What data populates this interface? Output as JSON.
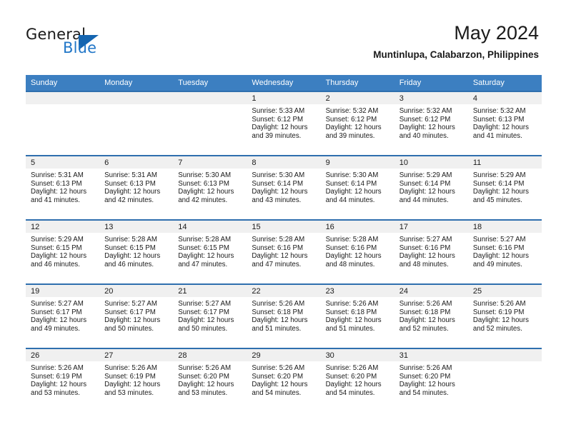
{
  "logo": {
    "word_top": "General",
    "word_bottom": "Blue",
    "triangle_color": "#1565b0",
    "blue_text_color": "#2277c8"
  },
  "header": {
    "title": "May 2024",
    "subtitle": "Muntinlupa, Calabarzon, Philippines"
  },
  "theme": {
    "header_row_bg": "#3c7fc1",
    "row_border": "#2f6fae",
    "daynum_band_bg": "#f0f0f0"
  },
  "weekday_headers": [
    "Sunday",
    "Monday",
    "Tuesday",
    "Wednesday",
    "Thursday",
    "Friday",
    "Saturday"
  ],
  "weeks": [
    [
      {
        "day": "",
        "sunrise": "",
        "sunset": "",
        "daylight_line1": "",
        "daylight_line2": ""
      },
      {
        "day": "",
        "sunrise": "",
        "sunset": "",
        "daylight_line1": "",
        "daylight_line2": ""
      },
      {
        "day": "",
        "sunrise": "",
        "sunset": "",
        "daylight_line1": "",
        "daylight_line2": ""
      },
      {
        "day": "1",
        "sunrise": "Sunrise: 5:33 AM",
        "sunset": "Sunset: 6:12 PM",
        "daylight_line1": "Daylight: 12 hours",
        "daylight_line2": "and 39 minutes."
      },
      {
        "day": "2",
        "sunrise": "Sunrise: 5:32 AM",
        "sunset": "Sunset: 6:12 PM",
        "daylight_line1": "Daylight: 12 hours",
        "daylight_line2": "and 39 minutes."
      },
      {
        "day": "3",
        "sunrise": "Sunrise: 5:32 AM",
        "sunset": "Sunset: 6:12 PM",
        "daylight_line1": "Daylight: 12 hours",
        "daylight_line2": "and 40 minutes."
      },
      {
        "day": "4",
        "sunrise": "Sunrise: 5:32 AM",
        "sunset": "Sunset: 6:13 PM",
        "daylight_line1": "Daylight: 12 hours",
        "daylight_line2": "and 41 minutes."
      }
    ],
    [
      {
        "day": "5",
        "sunrise": "Sunrise: 5:31 AM",
        "sunset": "Sunset: 6:13 PM",
        "daylight_line1": "Daylight: 12 hours",
        "daylight_line2": "and 41 minutes."
      },
      {
        "day": "6",
        "sunrise": "Sunrise: 5:31 AM",
        "sunset": "Sunset: 6:13 PM",
        "daylight_line1": "Daylight: 12 hours",
        "daylight_line2": "and 42 minutes."
      },
      {
        "day": "7",
        "sunrise": "Sunrise: 5:30 AM",
        "sunset": "Sunset: 6:13 PM",
        "daylight_line1": "Daylight: 12 hours",
        "daylight_line2": "and 42 minutes."
      },
      {
        "day": "8",
        "sunrise": "Sunrise: 5:30 AM",
        "sunset": "Sunset: 6:14 PM",
        "daylight_line1": "Daylight: 12 hours",
        "daylight_line2": "and 43 minutes."
      },
      {
        "day": "9",
        "sunrise": "Sunrise: 5:30 AM",
        "sunset": "Sunset: 6:14 PM",
        "daylight_line1": "Daylight: 12 hours",
        "daylight_line2": "and 44 minutes."
      },
      {
        "day": "10",
        "sunrise": "Sunrise: 5:29 AM",
        "sunset": "Sunset: 6:14 PM",
        "daylight_line1": "Daylight: 12 hours",
        "daylight_line2": "and 44 minutes."
      },
      {
        "day": "11",
        "sunrise": "Sunrise: 5:29 AM",
        "sunset": "Sunset: 6:14 PM",
        "daylight_line1": "Daylight: 12 hours",
        "daylight_line2": "and 45 minutes."
      }
    ],
    [
      {
        "day": "12",
        "sunrise": "Sunrise: 5:29 AM",
        "sunset": "Sunset: 6:15 PM",
        "daylight_line1": "Daylight: 12 hours",
        "daylight_line2": "and 46 minutes."
      },
      {
        "day": "13",
        "sunrise": "Sunrise: 5:28 AM",
        "sunset": "Sunset: 6:15 PM",
        "daylight_line1": "Daylight: 12 hours",
        "daylight_line2": "and 46 minutes."
      },
      {
        "day": "14",
        "sunrise": "Sunrise: 5:28 AM",
        "sunset": "Sunset: 6:15 PM",
        "daylight_line1": "Daylight: 12 hours",
        "daylight_line2": "and 47 minutes."
      },
      {
        "day": "15",
        "sunrise": "Sunrise: 5:28 AM",
        "sunset": "Sunset: 6:16 PM",
        "daylight_line1": "Daylight: 12 hours",
        "daylight_line2": "and 47 minutes."
      },
      {
        "day": "16",
        "sunrise": "Sunrise: 5:28 AM",
        "sunset": "Sunset: 6:16 PM",
        "daylight_line1": "Daylight: 12 hours",
        "daylight_line2": "and 48 minutes."
      },
      {
        "day": "17",
        "sunrise": "Sunrise: 5:27 AM",
        "sunset": "Sunset: 6:16 PM",
        "daylight_line1": "Daylight: 12 hours",
        "daylight_line2": "and 48 minutes."
      },
      {
        "day": "18",
        "sunrise": "Sunrise: 5:27 AM",
        "sunset": "Sunset: 6:16 PM",
        "daylight_line1": "Daylight: 12 hours",
        "daylight_line2": "and 49 minutes."
      }
    ],
    [
      {
        "day": "19",
        "sunrise": "Sunrise: 5:27 AM",
        "sunset": "Sunset: 6:17 PM",
        "daylight_line1": "Daylight: 12 hours",
        "daylight_line2": "and 49 minutes."
      },
      {
        "day": "20",
        "sunrise": "Sunrise: 5:27 AM",
        "sunset": "Sunset: 6:17 PM",
        "daylight_line1": "Daylight: 12 hours",
        "daylight_line2": "and 50 minutes."
      },
      {
        "day": "21",
        "sunrise": "Sunrise: 5:27 AM",
        "sunset": "Sunset: 6:17 PM",
        "daylight_line1": "Daylight: 12 hours",
        "daylight_line2": "and 50 minutes."
      },
      {
        "day": "22",
        "sunrise": "Sunrise: 5:26 AM",
        "sunset": "Sunset: 6:18 PM",
        "daylight_line1": "Daylight: 12 hours",
        "daylight_line2": "and 51 minutes."
      },
      {
        "day": "23",
        "sunrise": "Sunrise: 5:26 AM",
        "sunset": "Sunset: 6:18 PM",
        "daylight_line1": "Daylight: 12 hours",
        "daylight_line2": "and 51 minutes."
      },
      {
        "day": "24",
        "sunrise": "Sunrise: 5:26 AM",
        "sunset": "Sunset: 6:18 PM",
        "daylight_line1": "Daylight: 12 hours",
        "daylight_line2": "and 52 minutes."
      },
      {
        "day": "25",
        "sunrise": "Sunrise: 5:26 AM",
        "sunset": "Sunset: 6:19 PM",
        "daylight_line1": "Daylight: 12 hours",
        "daylight_line2": "and 52 minutes."
      }
    ],
    [
      {
        "day": "26",
        "sunrise": "Sunrise: 5:26 AM",
        "sunset": "Sunset: 6:19 PM",
        "daylight_line1": "Daylight: 12 hours",
        "daylight_line2": "and 53 minutes."
      },
      {
        "day": "27",
        "sunrise": "Sunrise: 5:26 AM",
        "sunset": "Sunset: 6:19 PM",
        "daylight_line1": "Daylight: 12 hours",
        "daylight_line2": "and 53 minutes."
      },
      {
        "day": "28",
        "sunrise": "Sunrise: 5:26 AM",
        "sunset": "Sunset: 6:20 PM",
        "daylight_line1": "Daylight: 12 hours",
        "daylight_line2": "and 53 minutes."
      },
      {
        "day": "29",
        "sunrise": "Sunrise: 5:26 AM",
        "sunset": "Sunset: 6:20 PM",
        "daylight_line1": "Daylight: 12 hours",
        "daylight_line2": "and 54 minutes."
      },
      {
        "day": "30",
        "sunrise": "Sunrise: 5:26 AM",
        "sunset": "Sunset: 6:20 PM",
        "daylight_line1": "Daylight: 12 hours",
        "daylight_line2": "and 54 minutes."
      },
      {
        "day": "31",
        "sunrise": "Sunrise: 5:26 AM",
        "sunset": "Sunset: 6:20 PM",
        "daylight_line1": "Daylight: 12 hours",
        "daylight_line2": "and 54 minutes."
      },
      {
        "day": "",
        "sunrise": "",
        "sunset": "",
        "daylight_line1": "",
        "daylight_line2": ""
      }
    ]
  ]
}
